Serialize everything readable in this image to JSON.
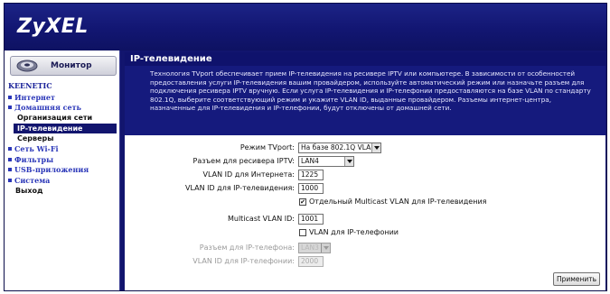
{
  "brand": {
    "logo": "ZyXEL"
  },
  "sidebar": {
    "monitor_label": "Монитор",
    "nav_title": "KEENETIC",
    "items": [
      {
        "label": "Интернет",
        "level": 0
      },
      {
        "label": "Домашняя сеть",
        "level": 0
      },
      {
        "label": "Организация сети",
        "level": 1
      },
      {
        "label": "IP-телевидение",
        "level": 1,
        "selected": true
      },
      {
        "label": "Серверы",
        "level": 1
      },
      {
        "label": "Сеть Wi-Fi",
        "level": 0
      },
      {
        "label": "Фильтры",
        "level": 0
      },
      {
        "label": "USB-приложения",
        "level": 0
      },
      {
        "label": "Система",
        "level": 0
      },
      {
        "label": "Выход",
        "level": 2
      }
    ]
  },
  "page": {
    "title": "IP-телевидение",
    "description": "Технология TVport обеспечивает прием IP-телевидения на ресивере IPTV или компьютере. В зависимости от особенностей предоставления услуги IP-телевидения вашим провайдером, используйте автоматический режим или назначьте разъем для подключения ресивера IPTV вручную. Если услуга IP-телевидения и IP-телефонии предоставляются на базе VLAN по стандарту 802.1Q, выберите соответствующий режим и укажите VLAN ID, выданные провайдером. Разъемы интернет-центра, назначенные для IP-телевидения и IP-телефонии, будут отключены от домашней сети."
  },
  "form": {
    "mode_label": "Режим TVport:",
    "mode_value": "На базе 802.1Q VLAN",
    "port_label": "Разъем для ресивера IPTV:",
    "port_value": "LAN4",
    "inet_vlan_label": "VLAN ID для Интернета:",
    "inet_vlan_value": "1225",
    "iptv_vlan_label": "VLAN ID для IP-телевидения:",
    "iptv_vlan_value": "1000",
    "multicast_check_label": "Отдельный Multicast VLAN для IP-телевидения",
    "multicast_check_mark": "✔",
    "multicast_vlan_label": "Multicast VLAN ID:",
    "multicast_vlan_value": "1001",
    "voip_check_label": "VLAN для IP-телефонии",
    "phone_port_label": "Разъем для IP-телефона:",
    "phone_port_value": "LAN3",
    "phone_vlan_label": "VLAN ID для IP-телефонии:",
    "phone_vlan_value": "2000",
    "apply_label": "Применить"
  },
  "colors": {
    "frame": "#12156e",
    "title_bar": "#0f126c",
    "description_bg": "#151a7d",
    "nav_link": "#2a36b8"
  }
}
